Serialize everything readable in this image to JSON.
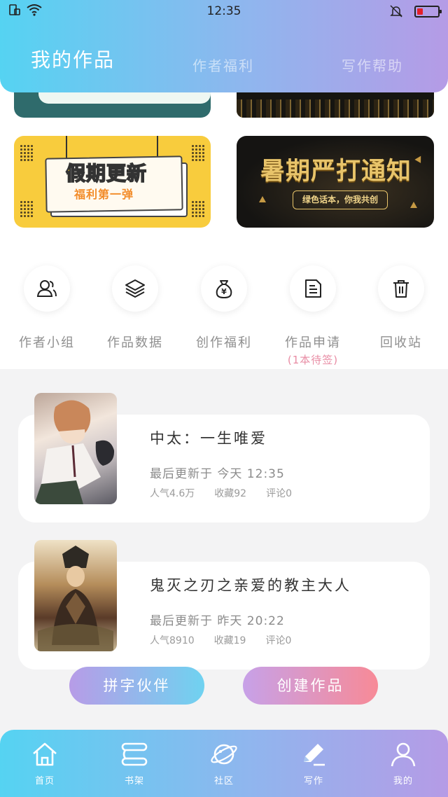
{
  "status_bar": {
    "time": "12:35"
  },
  "header": {
    "tabs": [
      {
        "label": "我的作品",
        "active": true
      },
      {
        "label": "作者福利",
        "active": false
      },
      {
        "label": "写作帮助",
        "active": false
      }
    ]
  },
  "banners": {
    "holiday": {
      "title": "假期更新",
      "subtitle": "福利第一弹"
    },
    "summer": {
      "title": "暑期严打通知",
      "subtitle": "绿色话本，你我共创"
    }
  },
  "shortcuts": [
    {
      "label": "作者小组",
      "icon": "group-icon"
    },
    {
      "label": "作品数据",
      "icon": "layers-icon"
    },
    {
      "label": "创作福利",
      "icon": "money-bag-icon"
    },
    {
      "label": "作品申请",
      "icon": "document-icon",
      "note": "(1本待签)"
    },
    {
      "label": "回收站",
      "icon": "trash-icon"
    }
  ],
  "works": [
    {
      "title": "中太：一生唯爱",
      "updated": "最后更新于 今天 12:35",
      "popularity": "人气4.6万",
      "favorites": "收藏92",
      "comments": "评论0"
    },
    {
      "title": "鬼灭之刃之亲爱的教主大人",
      "updated": "最后更新于 昨天 20:22",
      "popularity": "人气8910",
      "favorites": "收藏19",
      "comments": "评论0"
    }
  ],
  "actions": {
    "partner": "拼字伙伴",
    "create": "创建作品"
  },
  "bottom_nav": [
    {
      "label": "首页",
      "icon": "home-icon"
    },
    {
      "label": "书架",
      "icon": "bookshelf-icon"
    },
    {
      "label": "社区",
      "icon": "planet-icon"
    },
    {
      "label": "写作",
      "icon": "pen-icon"
    },
    {
      "label": "我的",
      "icon": "user-icon"
    }
  ],
  "colors": {
    "gradient_start": "#55d3f2",
    "gradient_end": "#b59be6",
    "accent_pink": "#f78a97"
  }
}
